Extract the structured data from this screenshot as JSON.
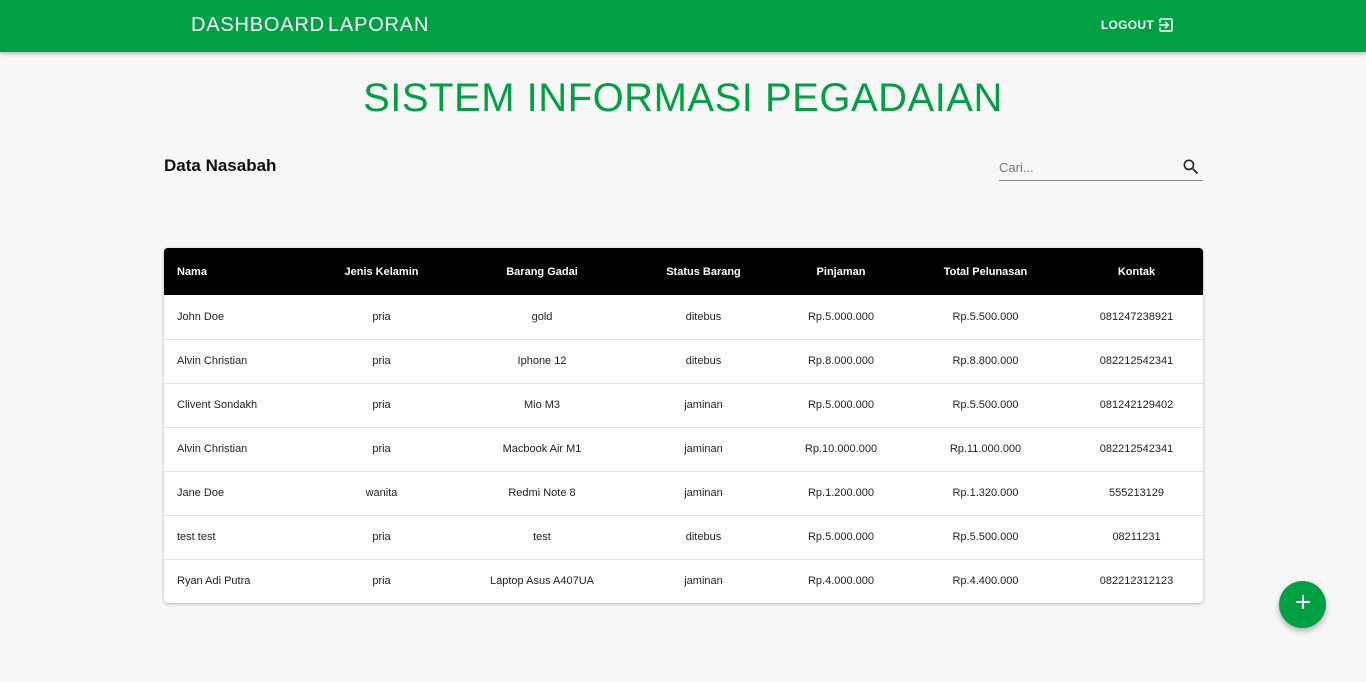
{
  "nav": {
    "dashboard_label": "DASHBOARD",
    "laporan_label": "LAPORAN",
    "logout_label": "LOGOUT",
    "logout_icon": "logout-icon",
    "color": "#00a143"
  },
  "page": {
    "title": "SISTEM INFORMASI PEGADAIAN",
    "section_title": "Data Nasabah"
  },
  "search": {
    "placeholder": "Cari...",
    "value": "",
    "icon": "search-icon"
  },
  "table": {
    "columns": [
      "Nama",
      "Jenis Kelamin",
      "Barang Gadai",
      "Status Barang",
      "Pinjaman",
      "Total Pelunasan",
      "Kontak"
    ],
    "rows": [
      [
        "John Doe",
        "pria",
        "gold",
        "ditebus",
        "Rp.5.000.000",
        "Rp.5.500.000",
        "081247238921"
      ],
      [
        "Alvin Christian",
        "pria",
        "Iphone 12",
        "ditebus",
        "Rp.8.000.000",
        "Rp.8.800.000",
        "082212542341"
      ],
      [
        "Clivent Sondakh",
        "pria",
        "Mio M3",
        "jaminan",
        "Rp.5.000.000",
        "Rp.5.500.000",
        "081242129402"
      ],
      [
        "Alvin Christian",
        "pria",
        "Macbook Air M1",
        "jaminan",
        "Rp.10.000.000",
        "Rp.11.000.000",
        "082212542341"
      ],
      [
        "Jane Doe",
        "wanita",
        "Redmi Note 8",
        "jaminan",
        "Rp.1.200.000",
        "Rp.1.320.000",
        "555213129"
      ],
      [
        "test test",
        "pria",
        "test",
        "ditebus",
        "Rp.5.000.000",
        "Rp.5.500.000",
        "08211231"
      ],
      [
        "Ryan Adi Putra",
        "pria",
        "Laptop Asus A407UA",
        "jaminan",
        "Rp.4.000.000",
        "Rp.4.400.000",
        "082212312123"
      ]
    ]
  },
  "fab": {
    "icon": "plus-icon"
  }
}
